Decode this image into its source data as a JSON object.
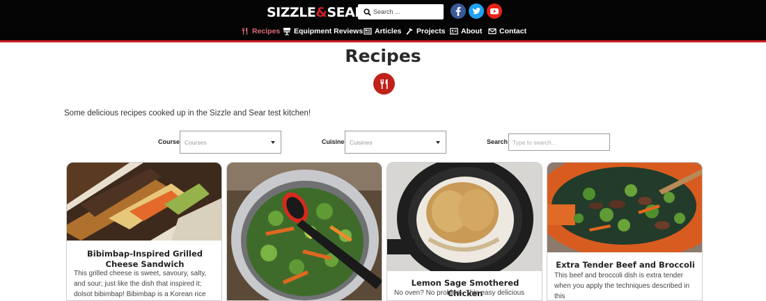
{
  "header": {
    "logo_left": "SIZZLE",
    "logo_amp": "&",
    "logo_right": "SEAR",
    "search_placeholder": "Search ...",
    "social": [
      "facebook-icon",
      "twitter-icon",
      "youtube-icon"
    ],
    "nav": [
      {
        "label": "Recipes",
        "icon": "utensils-icon",
        "active": true
      },
      {
        "label": "Equipment Reviews",
        "icon": "grill-icon"
      },
      {
        "label": "Articles",
        "icon": "newspaper-icon"
      },
      {
        "label": "Projects",
        "icon": "hammer-icon"
      },
      {
        "label": "About",
        "icon": "id-card-icon"
      },
      {
        "label": "Contact",
        "icon": "envelope-icon"
      }
    ]
  },
  "page": {
    "title": "Recipes",
    "intro": "Some delicious recipes cooked up in the Sizzle and Sear test kitchen!"
  },
  "filters": {
    "course_label": "Course",
    "course_value": "Courses",
    "cuisine_label": "Cuisine",
    "cuisine_value": "Cuisines",
    "search_label": "Search",
    "search_placeholder": "Type to search..."
  },
  "cards": [
    {
      "title": "Bibimbap-Inspired Grilled Cheese Sandwich",
      "desc": "This grilled cheese is sweet, savoury, salty, and sour; just like the dish that inspired it; dolsot bibimbap! Bibimbap is a Korean rice dish cooked"
    },
    {
      "title": "",
      "desc": ""
    },
    {
      "title": "Lemon Sage Smothered Chicken",
      "desc": "No oven? No problem. This easy delicious"
    },
    {
      "title": "Extra Tender Beef and Broccoli",
      "desc": "This beef and broccoli dish is extra tender when you apply the techniques described in this"
    }
  ],
  "colors": {
    "brand_red": "#d21f26",
    "header_bg": "#050505",
    "nav_active": "#e06a7a"
  }
}
